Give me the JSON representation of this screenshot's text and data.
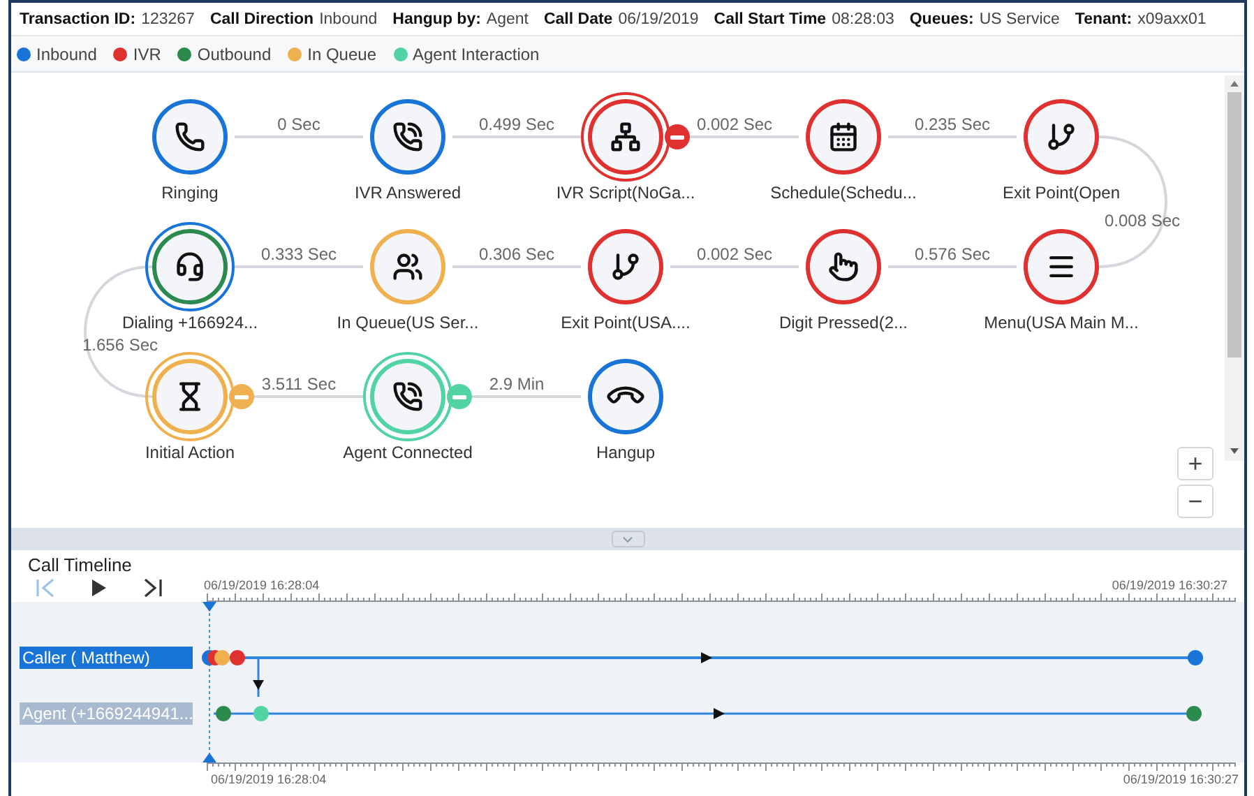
{
  "header": [
    {
      "label": "Transaction ID:",
      "value": "123267"
    },
    {
      "label": "Call Direction",
      "value": "Inbound"
    },
    {
      "label": "Hangup by:",
      "value": "Agent"
    },
    {
      "label": "Call Date",
      "value": "06/19/2019"
    },
    {
      "label": "Call Start Time",
      "value": "08:28:03"
    },
    {
      "label": "Queues:",
      "value": "US Service"
    },
    {
      "label": "Tenant:",
      "value": "x09axx01"
    }
  ],
  "legend": [
    {
      "label": "Inbound",
      "color": "#1874d6"
    },
    {
      "label": "IVR",
      "color": "#e03131"
    },
    {
      "label": "Outbound",
      "color": "#2b8a4e"
    },
    {
      "label": "In Queue",
      "color": "#efb04f"
    },
    {
      "label": "Agent Interaction",
      "color": "#52d3a4"
    }
  ],
  "flow": {
    "nodes": [
      {
        "label": "Ringing",
        "kind": "ringing",
        "rings": [
          {
            "color": "#1874d6"
          }
        ],
        "badge": false
      },
      {
        "label": "IVR Answered",
        "kind": "answered",
        "rings": [
          {
            "color": "#1874d6"
          }
        ],
        "badge": false
      },
      {
        "label": "IVR Script(NoGa...",
        "kind": "script",
        "rings": [
          {
            "color": "#e03131"
          },
          {
            "color": "#e03131"
          }
        ],
        "badge": true
      },
      {
        "label": "Schedule(Schedu...",
        "kind": "schedule",
        "rings": [
          {
            "color": "#e03131"
          }
        ],
        "badge": false
      },
      {
        "label": "Exit Point(Open",
        "kind": "exit",
        "rings": [
          {
            "color": "#e03131"
          }
        ],
        "badge": false
      },
      {
        "label": "Dialing +166924...",
        "kind": "dialing",
        "rings": [
          {
            "color": "#2b8a4e"
          },
          {
            "color": "#1874d6"
          }
        ],
        "badge": false
      },
      {
        "label": "In Queue(US Ser...",
        "kind": "queue",
        "rings": [
          {
            "color": "#efb04f"
          }
        ],
        "badge": false
      },
      {
        "label": "Exit Point(USA....",
        "kind": "exit",
        "rings": [
          {
            "color": "#e03131"
          }
        ],
        "badge": false
      },
      {
        "label": "Digit Pressed(2...",
        "kind": "digit",
        "rings": [
          {
            "color": "#e03131"
          }
        ],
        "badge": false
      },
      {
        "label": "Menu(USA Main M...",
        "kind": "menu",
        "rings": [
          {
            "color": "#e03131"
          }
        ],
        "badge": false
      },
      {
        "label": "Initial Action",
        "kind": "action",
        "rings": [
          {
            "color": "#efb04f"
          },
          {
            "color": "#efb04f"
          }
        ],
        "badge": true
      },
      {
        "label": "Agent Connected",
        "kind": "connected",
        "rings": [
          {
            "color": "#52d3a4"
          },
          {
            "color": "#52d3a4"
          }
        ],
        "badge": true
      },
      {
        "label": "Hangup",
        "kind": "hangup",
        "rings": [
          {
            "color": "#1874d6"
          }
        ],
        "badge": false
      }
    ],
    "transitions": [
      "0 Sec",
      "0.499 Sec",
      "0.002 Sec",
      "0.235 Sec",
      "0.008 Sec",
      "0.333 Sec",
      "0.306 Sec",
      "0.002 Sec",
      "0.576 Sec",
      "1.656 Sec",
      "3.511 Sec",
      "2.9 Min"
    ],
    "zoom_in": "+",
    "zoom_out": "−"
  },
  "timeline": {
    "title": "Call Timeline",
    "controls": [
      {
        "kind": "first",
        "disabled": true
      },
      {
        "kind": "play",
        "disabled": false
      },
      {
        "kind": "last",
        "disabled": false
      }
    ],
    "top_ruler": {
      "start": "06/19/2019 16:28:04",
      "end": "06/19/2019 16:30:27"
    },
    "tracks": [
      {
        "label": "Caller ( Matthew)",
        "selected": true,
        "events": [
          {
            "color": "#1874d6"
          },
          {
            "color": "#e03131"
          },
          {
            "color": "#efb04f"
          },
          {
            "color": "#e03131"
          },
          {
            "color": "#1874d6"
          }
        ]
      },
      {
        "label": "Agent (+1669244941...",
        "selected": false,
        "events": [
          {
            "color": "#2b8a4e"
          },
          {
            "color": "#52d3a4"
          },
          {
            "color": "#2b8a4e"
          }
        ]
      }
    ],
    "bottom_ruler": {
      "start": "06/19/2019 16:28:04",
      "end": "06/19/2019 16:30:27"
    }
  }
}
